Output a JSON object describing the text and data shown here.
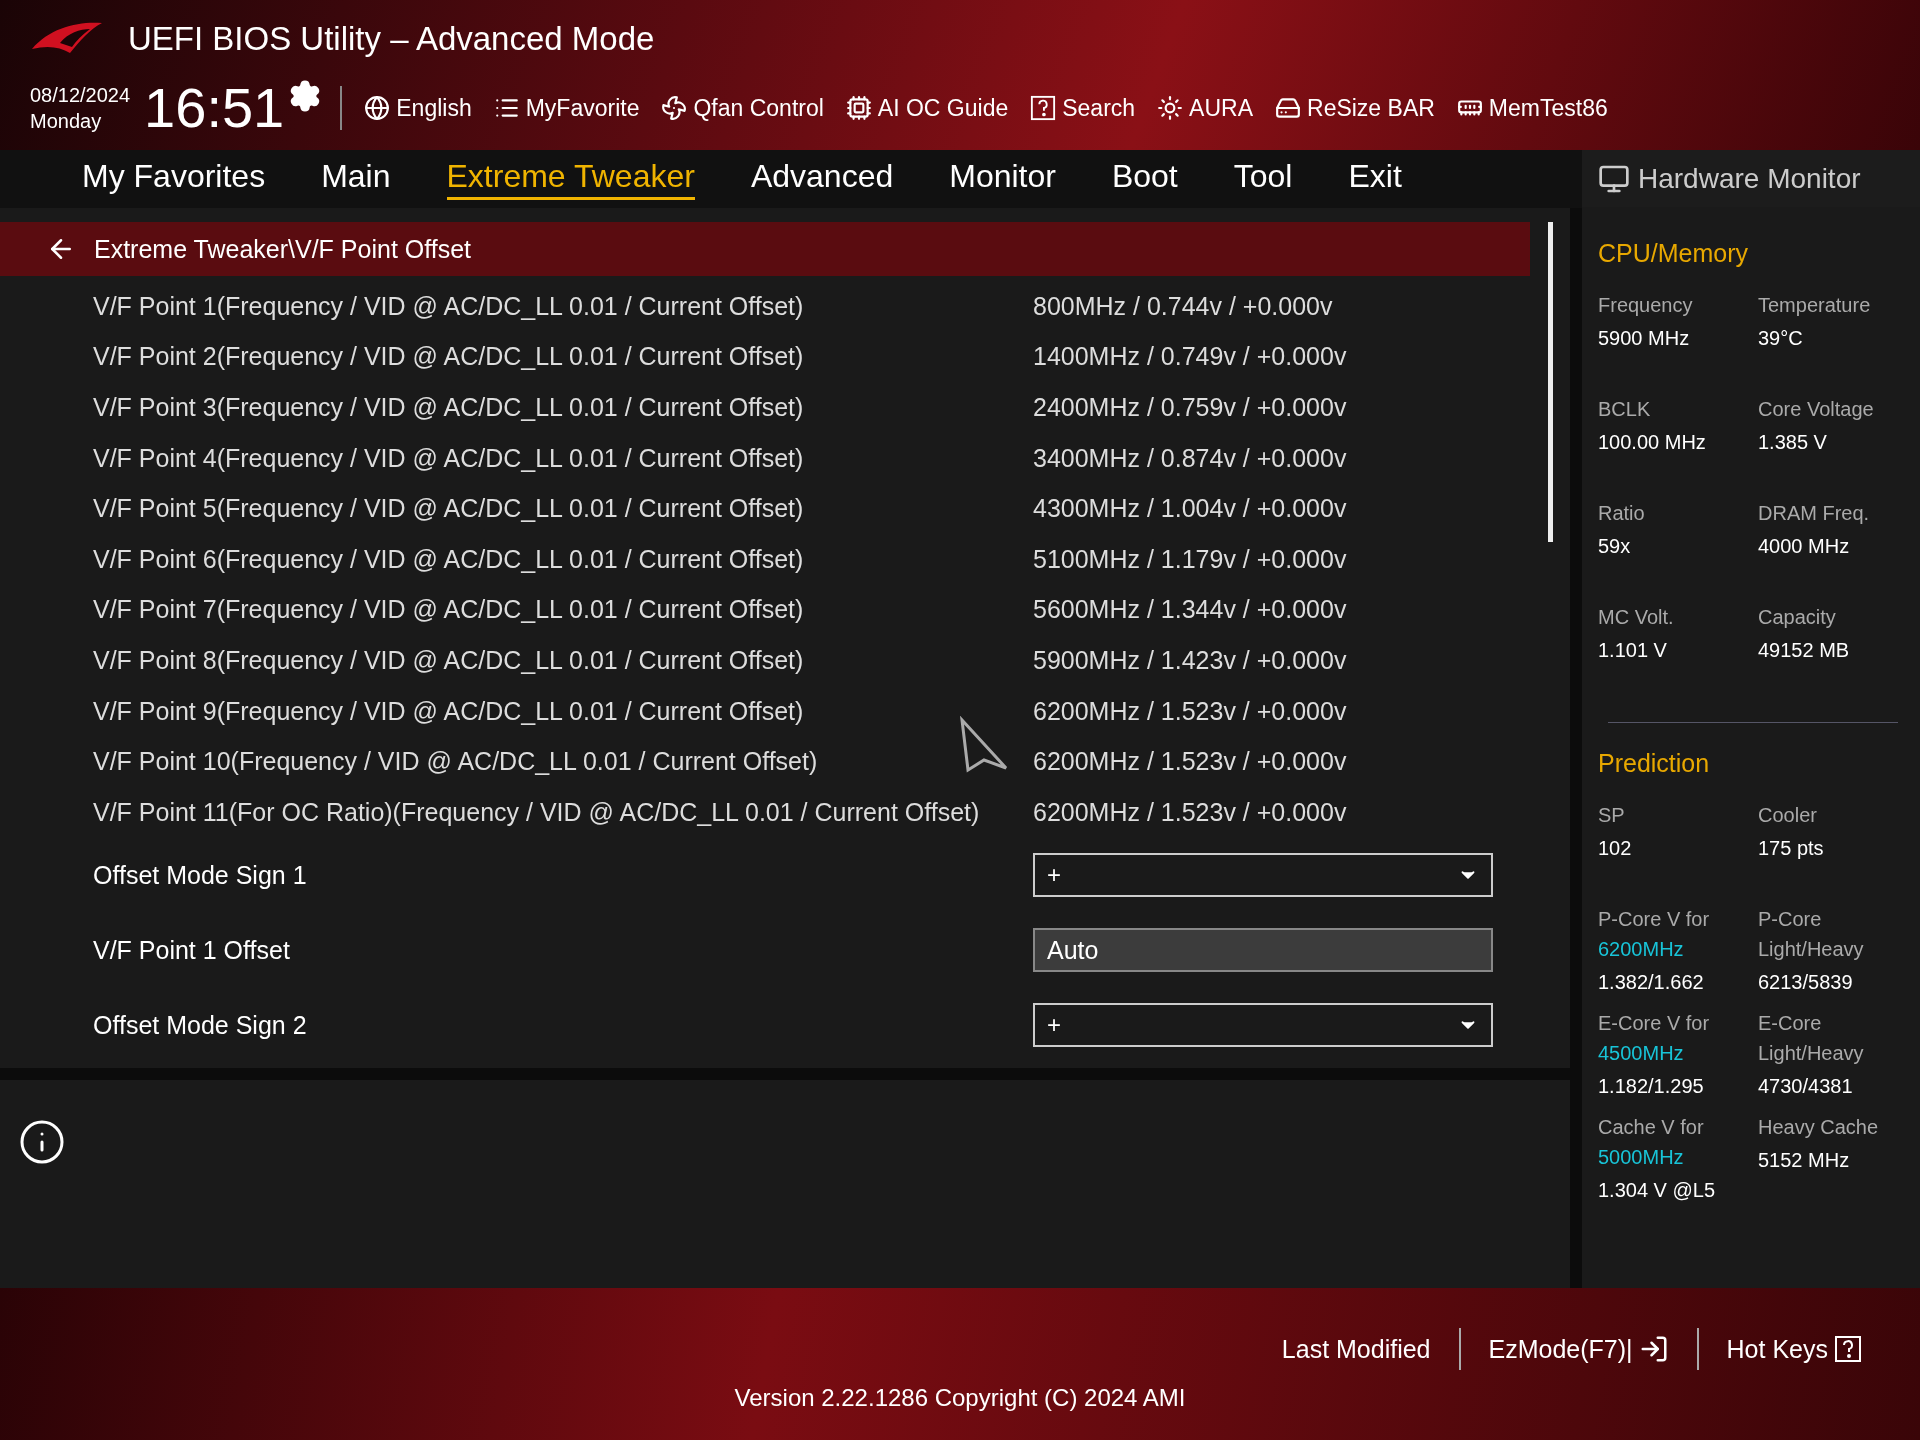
{
  "header": {
    "title": "UEFI BIOS Utility – Advanced Mode",
    "date": "08/12/2024",
    "day": "Monday",
    "time": "16:51",
    "toolbar": [
      {
        "label": "English",
        "kind": "globe"
      },
      {
        "label": "MyFavorite",
        "kind": "list"
      },
      {
        "label": "Qfan Control",
        "kind": "fan"
      },
      {
        "label": "AI OC Guide",
        "kind": "chip"
      },
      {
        "label": "Search",
        "kind": "help"
      },
      {
        "label": "AURA",
        "kind": "light"
      },
      {
        "label": "ReSize BAR",
        "kind": "card"
      },
      {
        "label": "MemTest86",
        "kind": "memory"
      }
    ]
  },
  "tabs": [
    {
      "label": "My Favorites",
      "selected": false
    },
    {
      "label": "Main",
      "selected": false
    },
    {
      "label": "Extreme Tweaker",
      "selected": true
    },
    {
      "label": "Advanced",
      "selected": false
    },
    {
      "label": "Monitor",
      "selected": false
    },
    {
      "label": "Boot",
      "selected": false
    },
    {
      "label": "Tool",
      "selected": false
    },
    {
      "label": "Exit",
      "selected": false
    }
  ],
  "breadcrumb": "Extreme Tweaker\\V/F Point Offset",
  "settings": [
    {
      "kind": "info",
      "label": "V/F Point 1(Frequency / VID @ AC/DC_LL 0.01 / Current Offset)",
      "value": "800MHz / 0.744v / +0.000v"
    },
    {
      "kind": "info",
      "label": "V/F Point 2(Frequency / VID @ AC/DC_LL 0.01 / Current Offset)",
      "value": "1400MHz / 0.749v / +0.000v"
    },
    {
      "kind": "info",
      "label": "V/F Point 3(Frequency / VID @ AC/DC_LL 0.01 / Current Offset)",
      "value": "2400MHz / 0.759v / +0.000v"
    },
    {
      "kind": "info",
      "label": "V/F Point 4(Frequency / VID @ AC/DC_LL 0.01 / Current Offset)",
      "value": "3400MHz / 0.874v / +0.000v"
    },
    {
      "kind": "info",
      "label": "V/F Point 5(Frequency / VID @ AC/DC_LL 0.01 / Current Offset)",
      "value": "4300MHz / 1.004v / +0.000v"
    },
    {
      "kind": "info",
      "label": "V/F Point 6(Frequency / VID @ AC/DC_LL 0.01 / Current Offset)",
      "value": "5100MHz / 1.179v / +0.000v"
    },
    {
      "kind": "info",
      "label": "V/F Point 7(Frequency / VID @ AC/DC_LL 0.01 / Current Offset)",
      "value": "5600MHz / 1.344v / +0.000v"
    },
    {
      "kind": "info",
      "label": "V/F Point 8(Frequency / VID @ AC/DC_LL 0.01 / Current Offset)",
      "value": "5900MHz / 1.423v / +0.000v"
    },
    {
      "kind": "info",
      "label": "V/F Point 9(Frequency / VID @ AC/DC_LL 0.01 / Current Offset)",
      "value": "6200MHz / 1.523v / +0.000v"
    },
    {
      "kind": "info",
      "label": "V/F Point 10(Frequency / VID @ AC/DC_LL 0.01 / Current Offset)",
      "value": "6200MHz / 1.523v / +0.000v"
    },
    {
      "kind": "info",
      "label": "V/F Point 11(For OC Ratio)(Frequency / VID @ AC/DC_LL 0.01 / Current Offset)",
      "value": "6200MHz / 1.523v / +0.000v"
    },
    {
      "kind": "select",
      "label": "Offset Mode Sign 1",
      "value": "+"
    },
    {
      "kind": "input",
      "label": "V/F Point 1 Offset",
      "value": "Auto"
    },
    {
      "kind": "select",
      "label": "Offset Mode Sign 2",
      "value": "+"
    }
  ],
  "monitor": {
    "title": "Hardware Monitor",
    "sections": [
      {
        "title": "CPU/Memory",
        "items": [
          {
            "label": "Frequency",
            "value": "5900 MHz"
          },
          {
            "label": "Temperature",
            "value": "39°C"
          },
          {
            "label": "BCLK",
            "value": "100.00 MHz"
          },
          {
            "label": "Core Voltage",
            "value": "1.385 V"
          },
          {
            "label": "Ratio",
            "value": "59x"
          },
          {
            "label": "DRAM Freq.",
            "value": "4000 MHz"
          },
          {
            "label": "MC Volt.",
            "value": "1.101 V"
          },
          {
            "label": "Capacity",
            "value": "49152 MB"
          }
        ]
      },
      {
        "title": "Prediction",
        "items": [
          {
            "label": "SP",
            "value": "102"
          },
          {
            "label": "Cooler",
            "value": "175 pts"
          },
          {
            "label": "P-Core V for",
            "highlight": "6200MHz",
            "value": "1.382/1.662"
          },
          {
            "label": "P-Core Light/Heavy",
            "value": "6213/5839"
          },
          {
            "label": "E-Core V for",
            "highlight": "4500MHz",
            "value": "1.182/1.295"
          },
          {
            "label": "E-Core Light/Heavy",
            "value": "4730/4381"
          },
          {
            "label": "Cache V for",
            "highlight": "5000MHz",
            "value": "1.304 V @L5"
          },
          {
            "label": "Heavy Cache",
            "value": "5152 MHz"
          }
        ]
      }
    ]
  },
  "footer": {
    "actions": [
      {
        "label": "Last Modified",
        "kind": "plain"
      },
      {
        "label": "EzMode(F7)|",
        "kind": "exit"
      },
      {
        "label": "Hot Keys",
        "kind": "help"
      }
    ],
    "version": "Version 2.22.1286 Copyright (C) 2024 AMI"
  }
}
